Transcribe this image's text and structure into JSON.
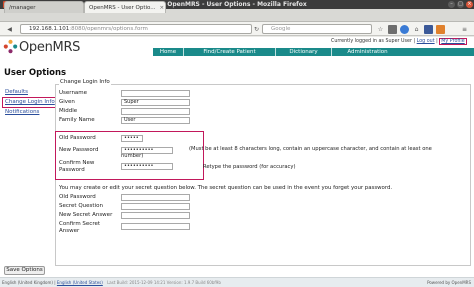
{
  "window": {
    "title": "OpenMRS - User Options - Mozilla Firefox",
    "minimize_glyph": "–",
    "maximize_glyph": "□",
    "close_glyph": "×"
  },
  "tabs": [
    {
      "label": "/manager"
    },
    {
      "label": "OpenMRS - User Optio..."
    }
  ],
  "tab_close_glyph": "×",
  "new_tab_glyph": "+",
  "navbar": {
    "back_glyph": "◀",
    "url_host": "192.168.1.101",
    "url_path": ":8080/openmrs/options.form",
    "search_placeholder": "Google",
    "reload_glyph": "↻",
    "star_glyph": "☆",
    "home_glyph": "⌂",
    "menu_glyph": "≡"
  },
  "header": {
    "logo_text": "OpenMRS",
    "logged_in_text": "Currently logged in as Super User",
    "log_out": "Log out",
    "my_profile": "My Profile",
    "separator": "|"
  },
  "menu": [
    "Home",
    "Find/Create Patient",
    "Dictionary",
    "Administration"
  ],
  "page_title": "User Options",
  "sidebar": {
    "items": [
      {
        "label": "Defaults"
      },
      {
        "label": "Change Login Info"
      },
      {
        "label": "Notifications"
      }
    ]
  },
  "form": {
    "legend": "Change Login Info",
    "username_label": "Username",
    "username_value": "",
    "given_label": "Given",
    "given_value": "Super",
    "middle_label": "Middle",
    "middle_value": "",
    "family_label": "Family Name",
    "family_value": "User",
    "old_password_label": "Old Password",
    "old_password_value": "•••••",
    "new_password_label": "New Password",
    "new_password_value": "••••••••••",
    "new_password_hint_line1": "(Must be at least 8 characters long, contain an uppercase character, and contain at least one",
    "new_password_hint_line2": "number)",
    "confirm_password_label_line1": "Confirm New",
    "confirm_password_label_line2": "Password",
    "confirm_password_value": "••••••••••",
    "confirm_password_hint": "Retype the password (for accuracy)",
    "secret_paragraph": "You may create or edit your secret question below. The secret question can be used in the event you forget your password.",
    "secret_old_password_label": "Old Password",
    "secret_question_label": "Secret Question",
    "new_secret_answer_label": "New Secret Answer",
    "confirm_secret_label_line1": "Confirm Secret",
    "confirm_secret_label_line2": "Answer",
    "save_button": "Save Options"
  },
  "footer": {
    "locale_current": "English (United Kingdom)",
    "locale_sep": "|",
    "locale_other": "English (United States)",
    "build_text": "Last Build: 2015-12-09 14:21  Version: 1.9.7 Build 60bf9b",
    "powered_by": "Powered by OpenMRS"
  },
  "colors": {
    "menu_bg": "#1a8a8a",
    "highlight_box": "#c2185b",
    "link": "#2a4d9b"
  }
}
